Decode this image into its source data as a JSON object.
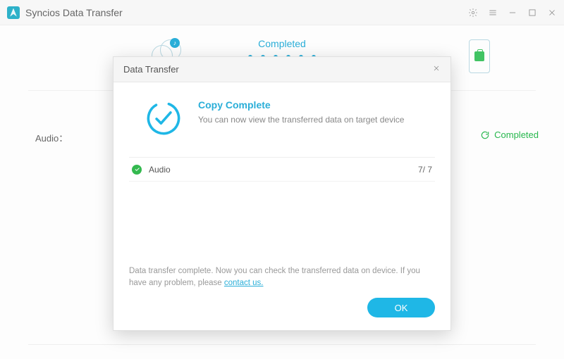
{
  "app": {
    "title": "Syncios Data Transfer"
  },
  "background": {
    "status": "Completed",
    "left_label": "Audio：",
    "right_status": "Completed"
  },
  "modal": {
    "title": "Data Transfer",
    "hero_title": "Copy Complete",
    "hero_sub": "You can now view the transferred data on target device",
    "item": {
      "label": "Audio",
      "count": "7/ 7"
    },
    "footer_prefix": "Data transfer complete. Now you can check the transferred data on device. If you have any problem, please ",
    "footer_link": "contact us.",
    "ok": "OK"
  }
}
